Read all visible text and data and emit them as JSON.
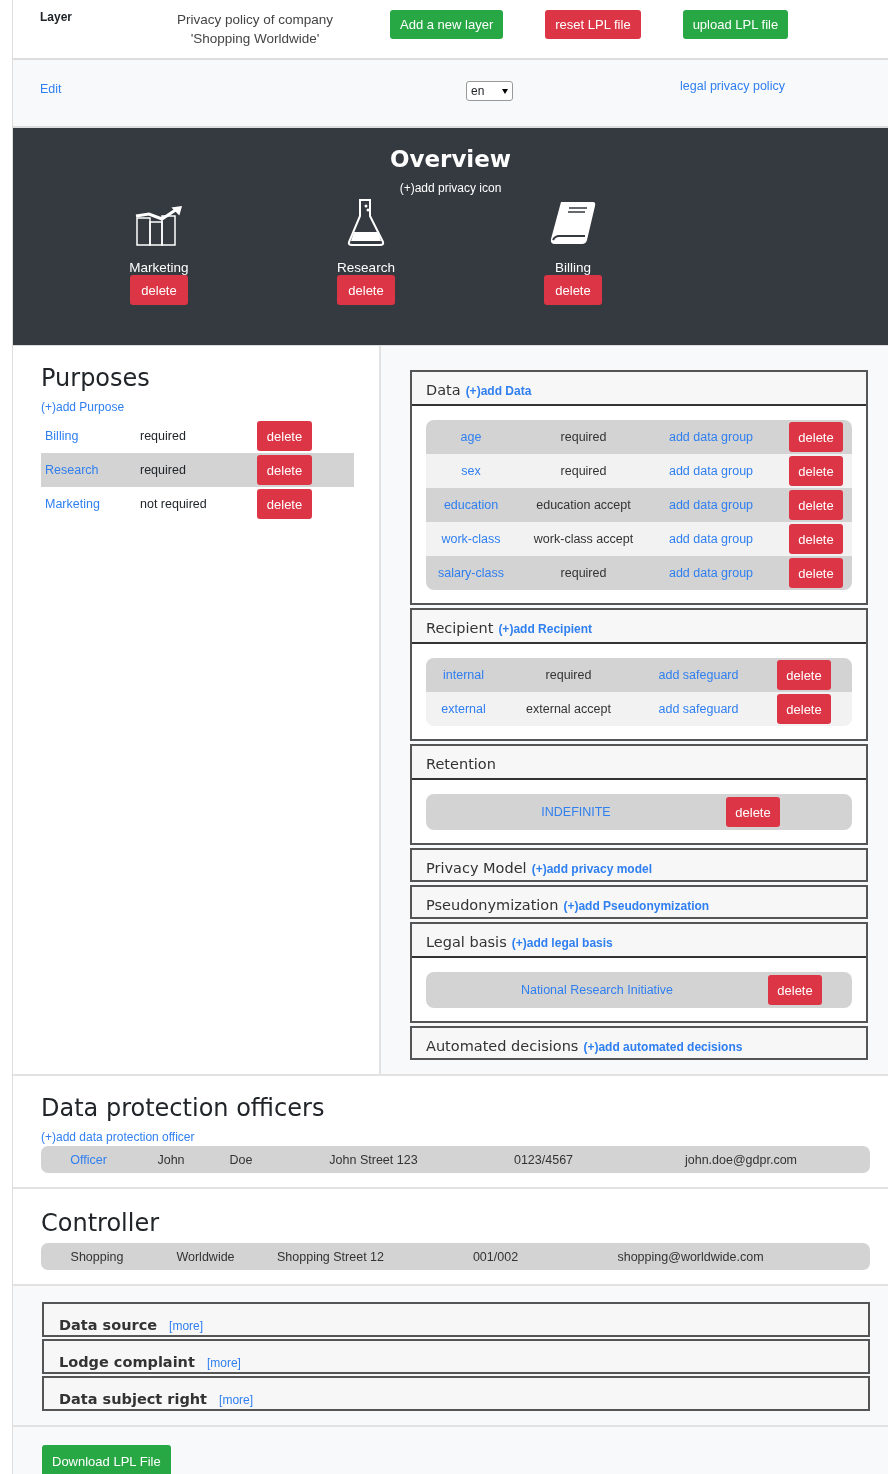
{
  "header": {
    "title": "Layer",
    "policy_lines": [
      "Privacy policy of company",
      "'Shopping Worldwide'"
    ],
    "buttons": [
      {
        "label": "Add a new layer",
        "kind": "success"
      },
      {
        "label": "reset LPL file",
        "kind": "danger"
      },
      {
        "label": "upload LPL file",
        "kind": "success"
      }
    ]
  },
  "nav": {
    "edit": "Edit",
    "language": "en",
    "link": "legal privacy policy"
  },
  "overview": {
    "title": "Overview",
    "add_link": "(+)add privacy icon",
    "icons": [
      {
        "label": "Marketing",
        "kind": "chart",
        "button": "delete"
      },
      {
        "label": "Research",
        "kind": "flask",
        "button": "delete"
      },
      {
        "label": "Billing",
        "kind": "book",
        "button": "delete"
      }
    ]
  },
  "purposes": {
    "title": "Purposes",
    "add_link": "(+)add Purpose",
    "rows": [
      {
        "name": "Billing",
        "status": "required",
        "selected": false,
        "button": "delete"
      },
      {
        "name": "Research",
        "status": "required",
        "selected": true,
        "button": "delete"
      },
      {
        "name": "Marketing",
        "status": "not required",
        "selected": false,
        "button": "delete"
      }
    ]
  },
  "cards": [
    {
      "title": "Data",
      "add_link": "(+)add Data",
      "rows": [
        {
          "name": "age",
          "status": "required",
          "action": "add data group",
          "button": "delete"
        },
        {
          "name": "sex",
          "status": "required",
          "action": "add data group",
          "button": "delete"
        },
        {
          "name": "education",
          "status": "education accept",
          "action": "add data group",
          "button": "delete"
        },
        {
          "name": "work-class",
          "status": "work-class accept",
          "action": "add data group",
          "button": "delete"
        },
        {
          "name": "salary-class",
          "status": "required",
          "action": "add data group",
          "button": "delete"
        }
      ]
    },
    {
      "title": "Recipient",
      "add_link": "(+)add Recipient",
      "rows": [
        {
          "name": "internal",
          "status": "required",
          "action": "add safeguard",
          "button": "delete"
        },
        {
          "name": "external",
          "status": "external accept",
          "action": "add safeguard",
          "button": "delete"
        }
      ]
    },
    {
      "title": "Retention",
      "rows": [
        {
          "name": "INDEFINITE",
          "button": "delete"
        }
      ]
    },
    {
      "title": "Privacy Model",
      "add_link": "(+)add privacy model"
    },
    {
      "title": "Pseudonymization",
      "add_link": "(+)add Pseudonymization"
    },
    {
      "title": "Legal basis",
      "add_link": "(+)add legal basis",
      "rows": [
        {
          "name": "National Research Initiative",
          "button": "delete"
        }
      ]
    },
    {
      "title": "Automated decisions",
      "add_link": "(+)add automated decisions"
    }
  ],
  "officers": {
    "title": "Data protection officers",
    "add_link": "(+)add data protection officer",
    "rows": [
      {
        "cells": [
          {
            "text": "Officer",
            "kind": "link"
          },
          {
            "text": "John",
            "kind": "text"
          },
          {
            "text": "Doe",
            "kind": "text"
          },
          {
            "text": "John Street 123",
            "kind": "text"
          },
          {
            "text": "0123/4567",
            "kind": "text"
          },
          {
            "text": "john.doe@gdpr.com",
            "kind": "text"
          }
        ]
      }
    ]
  },
  "controller": {
    "title": "Controller",
    "rows": [
      {
        "cells": [
          "Shopping",
          "Worldwide",
          "Shopping Street 12",
          "001/002",
          "shopping@worldwide.com"
        ]
      }
    ]
  },
  "sections": [
    {
      "title": "Data source",
      "link": "[more]"
    },
    {
      "title": "Lodge complaint",
      "link": "[more]"
    },
    {
      "title": "Data subject right",
      "link": "[more]"
    }
  ],
  "download": {
    "label": "Download LPL File"
  }
}
